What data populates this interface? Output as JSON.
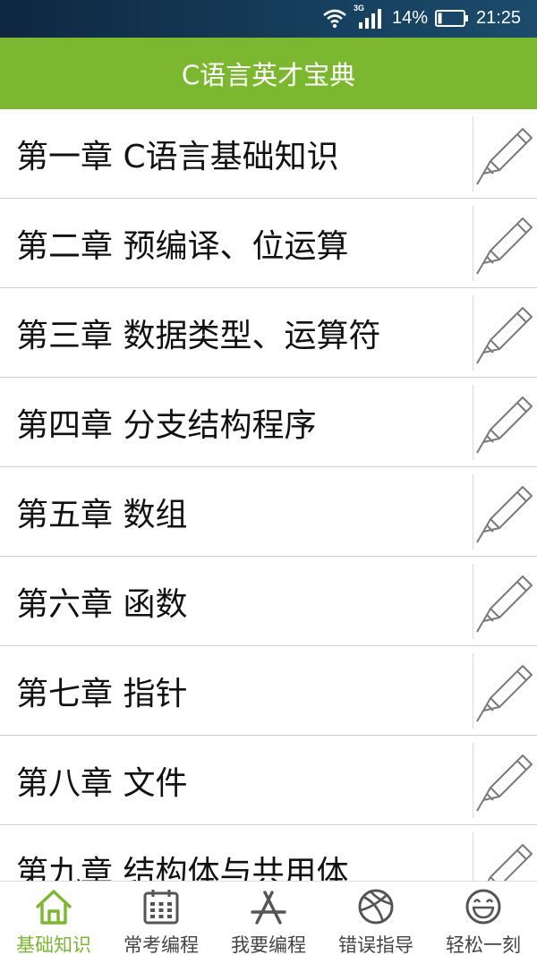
{
  "status_bar": {
    "network": "3G",
    "battery": "14%",
    "time": "21:25"
  },
  "header": {
    "title": "C语言英才宝典"
  },
  "chapters": [
    {
      "label": "第一章 C语言基础知识"
    },
    {
      "label": "第二章 预编译、位运算"
    },
    {
      "label": "第三章 数据类型、运算符"
    },
    {
      "label": "第四章 分支结构程序"
    },
    {
      "label": "第五章 数组"
    },
    {
      "label": "第六章 函数"
    },
    {
      "label": "第七章 指针"
    },
    {
      "label": "第八章 文件"
    },
    {
      "label": "第九章 结构体与共用体"
    }
  ],
  "bottom_nav": [
    {
      "label": "基础知识",
      "icon": "home-icon",
      "active": true
    },
    {
      "label": "常考编程",
      "icon": "calendar-icon",
      "active": false
    },
    {
      "label": "我要编程",
      "icon": "app-store-icon",
      "active": false
    },
    {
      "label": "错误指导",
      "icon": "basketball-icon",
      "active": false
    },
    {
      "label": "轻松一刻",
      "icon": "smiley-icon",
      "active": false
    }
  ],
  "colors": {
    "accent": "#7cb82f",
    "status_bar": "#163f5e",
    "icon_gray": "#555555"
  }
}
